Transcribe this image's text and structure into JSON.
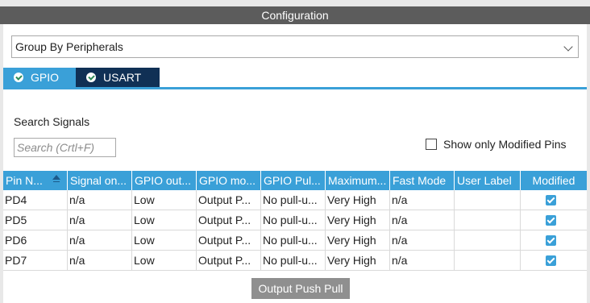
{
  "panel": {
    "title": "Configuration"
  },
  "group_by": {
    "selected": "Group By Peripherals"
  },
  "tabs": [
    {
      "label": "GPIO",
      "icon": "check-circle-icon",
      "active": true
    },
    {
      "label": "USART",
      "icon": "check-circle-icon",
      "active": false
    }
  ],
  "search": {
    "label": "Search Signals",
    "placeholder": "Search (Crtl+F)"
  },
  "filter": {
    "show_only_modified_label": "Show only Modified Pins",
    "checked": false
  },
  "table": {
    "columns": [
      "Pin N...",
      "Signal on...",
      "GPIO out...",
      "GPIO mo...",
      "GPIO Pul...",
      "Maximum...",
      "Fast Mode",
      "User Label",
      "Modified"
    ],
    "rows": [
      {
        "pin": "PD4",
        "signal": "n/a",
        "gpio_out": "Low",
        "gpio_mode": "Output P...",
        "gpio_pull": "No pull-u...",
        "maximum": "Very High",
        "fast_mode": "n/a",
        "user_label": "",
        "modified": true
      },
      {
        "pin": "PD5",
        "signal": "n/a",
        "gpio_out": "Low",
        "gpio_mode": "Output P...",
        "gpio_pull": "No pull-u...",
        "maximum": "Very High",
        "fast_mode": "n/a",
        "user_label": "",
        "modified": true
      },
      {
        "pin": "PD6",
        "signal": "n/a",
        "gpio_out": "Low",
        "gpio_mode": "Output P...",
        "gpio_pull": "No pull-u...",
        "maximum": "Very High",
        "fast_mode": "n/a",
        "user_label": "",
        "modified": true
      },
      {
        "pin": "PD7",
        "signal": "n/a",
        "gpio_out": "Low",
        "gpio_mode": "Output P...",
        "gpio_pull": "No pull-u...",
        "maximum": "Very High",
        "fast_mode": "n/a",
        "user_label": "",
        "modified": true
      }
    ]
  },
  "tooltip": {
    "text": "Output Push Pull"
  },
  "colors": {
    "accent": "#3aa0d8",
    "tab_inactive": "#103055",
    "titlebar": "#5c5c5c"
  }
}
